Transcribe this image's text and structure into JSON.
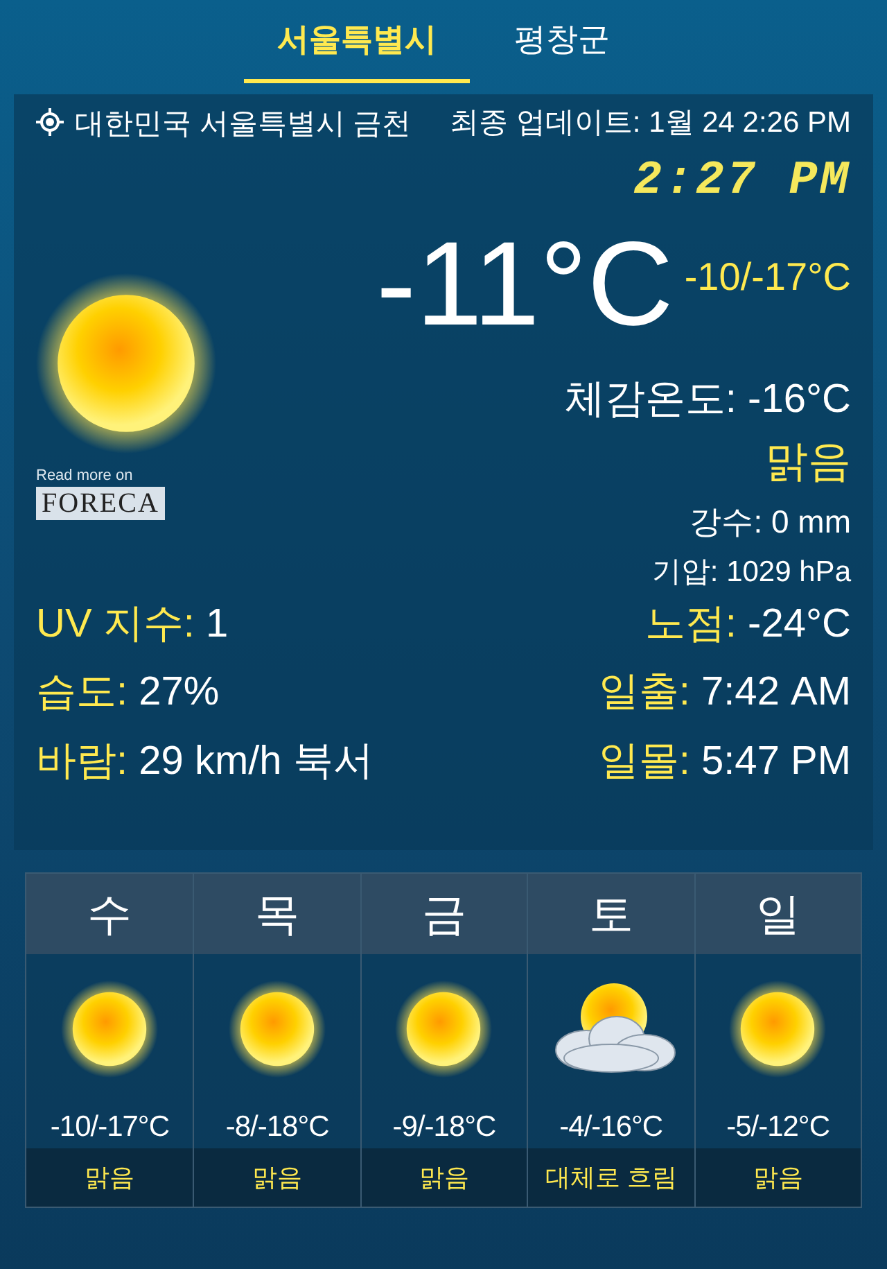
{
  "tabs": [
    {
      "label": "서울특별시",
      "selected": true
    },
    {
      "label": "평창군",
      "selected": false
    }
  ],
  "current": {
    "location": "대한민국 서울특별시 금천",
    "updated": "최종 업데이트: 1월 24  2:26 PM",
    "clock": "2:27 PM",
    "temperature": "-11°C",
    "high_low": "-10/-17°C",
    "feels_like": "체감온도: -16°C",
    "condition": "맑음",
    "precipitation": "강수: 0 mm",
    "pressure": "기압: 1029 hPa",
    "read_more": "Read more on",
    "provider": "FORECA"
  },
  "details_left": [
    {
      "label": "UV 지수:",
      "value": "1"
    },
    {
      "label": "습도:",
      "value": "27%"
    },
    {
      "label": "바람:",
      "value": "29 km/h 북서"
    }
  ],
  "details_right": [
    {
      "label": "노점:",
      "value": "-24°C"
    },
    {
      "label": "일출:",
      "value": "7:42 AM"
    },
    {
      "label": "일몰:",
      "value": "5:47 PM"
    }
  ],
  "forecast": [
    {
      "day": "수",
      "kind": "sun",
      "temps": "-10/-17°C",
      "condition": "맑음"
    },
    {
      "day": "목",
      "kind": "sun",
      "temps": "-8/-18°C",
      "condition": "맑음"
    },
    {
      "day": "금",
      "kind": "sun",
      "temps": "-9/-18°C",
      "condition": "맑음"
    },
    {
      "day": "토",
      "kind": "cloudy-sun",
      "temps": "-4/-16°C",
      "condition": "대체로 흐림"
    },
    {
      "day": "일",
      "kind": "sun",
      "temps": "-5/-12°C",
      "condition": "맑음"
    }
  ]
}
